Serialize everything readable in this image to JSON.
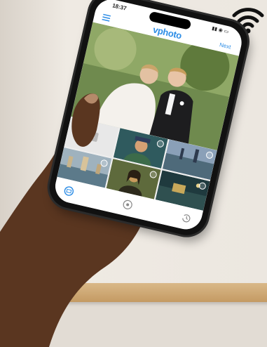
{
  "app": {
    "brand": "vphoto",
    "next_label": "Next"
  },
  "status_bar": {
    "time": "18:37",
    "signal_text": "▮▮ ◉ ▭"
  },
  "colors": {
    "accent": "#2d8de6",
    "wall": "#e9e4dd",
    "shelf": "#c9a06a",
    "skin": "#5a3620"
  },
  "icons": [
    "wifi-icon",
    "menu-icon",
    "camera-icon",
    "gallery-icon",
    "home-icon",
    "history-icon"
  ]
}
